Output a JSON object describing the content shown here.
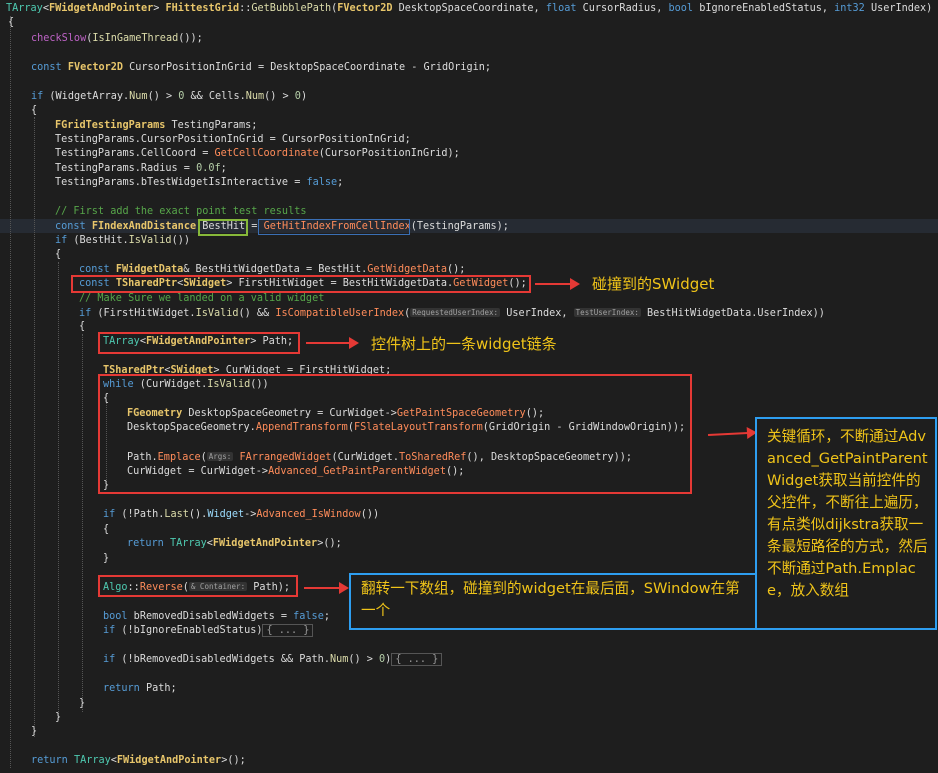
{
  "code_lines": [
    "TArray<FWidgetAndPointer> FHittestGrid::GetBubblePath(FVector2D DesktopSpaceCoordinate, float CursorRadius, bool bIgnoreEnabledStatus, int32 UserIndex)",
    "{",
    "checkSlow(IsInGameThread());",
    "const FVector2D CursorPositionInGrid = DesktopSpaceCoordinate - GridOrigin;",
    "if (WidgetArray.Num() > 0 && Cells.Num() > 0)",
    "{",
    "FGridTestingParams TestingParams;",
    "TestingParams.CursorPositionInGrid = CursorPositionInGrid;",
    "TestingParams.CellCoord = GetCellCoordinate(CursorPositionInGrid);",
    "TestingParams.Radius = 0.0f;",
    "TestingParams.bTestWidgetIsInteractive = false;",
    "// First add the exact point test results",
    "const FIndexAndDistance BestHit = GetHitIndexFromCellIndex(TestingParams);",
    "if (BestHit.IsValid())",
    "{",
    "const FWidgetData& BestHitWidgetData = BestHit.GetWidgetData();",
    "const TSharedPtr<SWidget> FirstHitWidget = BestHitWidgetData.GetWidget();",
    "// Make Sure we landed on a valid widget",
    "if (FirstHitWidget.IsValid() && IsCompatibleUserIndex(RequestedUserIndex: UserIndex, TestUserIndex: BestHitWidgetData.UserIndex))",
    "{",
    "TArray<FWidgetAndPointer> Path;",
    "TSharedPtr<SWidget> CurWidget = FirstHitWidget;",
    "while (CurWidget.IsValid())",
    "{",
    "FGeometry DesktopSpaceGeometry = CurWidget->GetPaintSpaceGeometry();",
    "DesktopSpaceGeometry.AppendTransform(FSlateLayoutTransform(GridOrigin - GridWindowOrigin));",
    "Path.Emplace(Args: FArrangedWidget(CurWidget.ToSharedRef(), DesktopSpaceGeometry));",
    "CurWidget = CurWidget->Advanced_GetPaintParentWidget();",
    "}",
    "if (!Path.Last().Widget->Advanced_IsWindow())",
    "{",
    "return TArray<FWidgetAndPointer>();",
    "}",
    "Algo::Reverse(& Container: Path);",
    "bool bRemovedDisabledWidgets = false;",
    "if (!bIgnoreEnabledStatus) { ... }",
    "if (!bRemovedDisabledWidgets && Path.Num() > 0) { ... }",
    "return Path;",
    "}",
    "}",
    "return TArray<FWidgetAndPointer>();"
  ],
  "annotations": {
    "hit_widget": "碰撞到的SWidget",
    "widget_chain": "控件树上的一条widget链条",
    "key_loop": "关键循环，不断通过Advanced_GetPaintParentWidget获取当前控件的 父控件，不断往上遍历，有点类似dijkstra获取一条最短路径的方式，然后不断通过Path.Emplace，放入数组",
    "reverse": "翻转一下数组，碰撞到的widget在最后面，SWindow在第一个"
  },
  "colors": {
    "background": "#1e1e1e",
    "keyword": "#569cd6",
    "type": "#4ec9b0",
    "function": "#dcdcaa",
    "comment": "#57a64a",
    "annotation_text": "#f0c419",
    "red_box": "#e53935",
    "blue_box": "#2e9ef0",
    "green_box": "#86b83a"
  }
}
